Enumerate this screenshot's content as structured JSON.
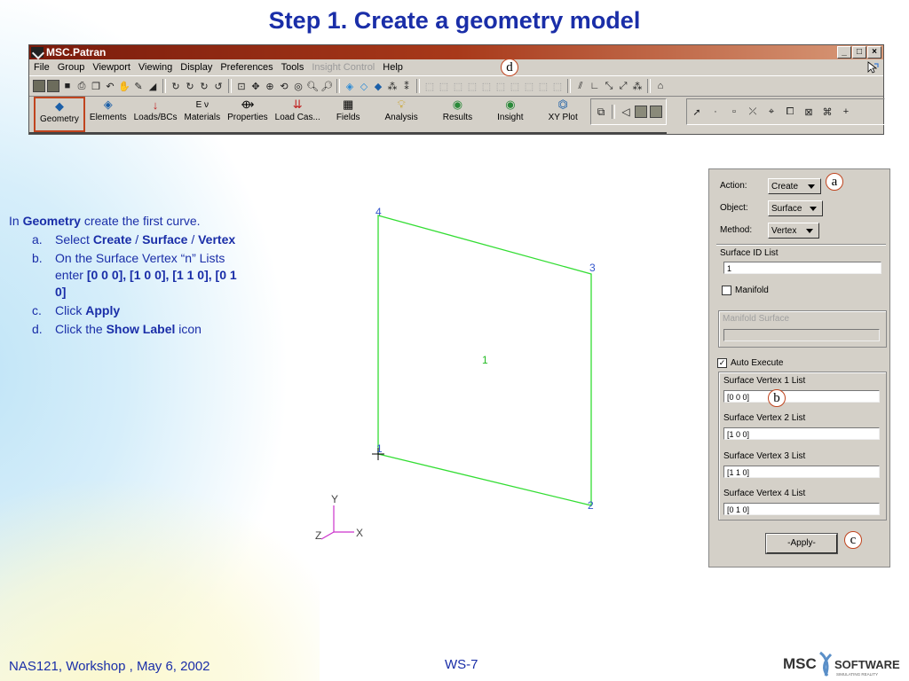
{
  "slide": {
    "title": "Step 1. Create a geometry model",
    "footer_left": "NAS121, Workshop , May 6, 2002",
    "footer_center": "WS-7",
    "logo_text_1": "MSC",
    "logo_text_2": "SOFTWARE",
    "logo_tagline": "SIMULATING REALITY"
  },
  "window": {
    "title": "MSC.Patran",
    "controls": [
      "_",
      "□",
      "×"
    ]
  },
  "menubar": {
    "items": [
      "File",
      "Group",
      "Viewport",
      "Viewing",
      "Display",
      "Preferences",
      "Tools",
      "Insight Control",
      "Help"
    ],
    "disabled": [
      "Insight Control"
    ]
  },
  "app_buttons": [
    {
      "label": "Geometry",
      "icon": "geometry-cube-icon",
      "active": true
    },
    {
      "label": "Elements",
      "icon": "elements-mesh-icon"
    },
    {
      "label": "Loads/BCs",
      "icon": "loads-arrow-icon"
    },
    {
      "label": "Materials",
      "icon": "materials-icon"
    },
    {
      "label": "Properties",
      "icon": "properties-icon"
    },
    {
      "label": "Load Cas...",
      "icon": "load-cases-icon"
    },
    {
      "label": "Fields",
      "icon": "fields-table-icon"
    },
    {
      "label": "Analysis",
      "icon": "analysis-bulb-icon"
    },
    {
      "label": "Results",
      "icon": "results-icon"
    },
    {
      "label": "Insight",
      "icon": "insight-icon"
    },
    {
      "label": "XY Plot",
      "icon": "xy-plot-icon"
    }
  ],
  "instructions": {
    "intro_pre": "In ",
    "intro_bold": "Geometry",
    "intro_post": " create the first curve.",
    "steps": [
      {
        "mark": "a.",
        "parts": [
          [
            "Select ",
            false
          ],
          [
            "Create",
            true
          ],
          [
            " / ",
            false
          ],
          [
            "Surface",
            true
          ],
          [
            " / ",
            false
          ],
          [
            "Vertex",
            true
          ]
        ]
      },
      {
        "mark": "b.",
        "parts": [
          [
            "On the Surface Vertex “n” Lists enter ",
            false
          ],
          [
            "[0 0 0], [1 0 0], [1 1 0], [0 1 0]",
            true
          ]
        ]
      },
      {
        "mark": "c.",
        "parts": [
          [
            "Click ",
            false
          ],
          [
            "Apply",
            true
          ]
        ]
      },
      {
        "mark": "d.",
        "parts": [
          [
            "Click the ",
            false
          ],
          [
            "Show Label",
            true
          ],
          [
            " icon",
            false
          ]
        ]
      }
    ]
  },
  "callouts": {
    "a": "a",
    "b": "b",
    "c": "c",
    "d": "d"
  },
  "form": {
    "action_label": "Action:",
    "action_value": "Create",
    "object_label": "Object:",
    "object_value": "Surface",
    "method_label": "Method:",
    "method_value": "Vertex",
    "surface_id_label": "Surface ID List",
    "surface_id_value": "1",
    "manifold_label": "Manifold",
    "manifold_checked": false,
    "manifold_surface_label": "Manifold Surface",
    "auto_execute_label": "Auto Execute",
    "auto_execute_checked": true,
    "vertex_lists": [
      {
        "label": "Surface Vertex 1 List",
        "value": "[0 0 0]"
      },
      {
        "label": "Surface Vertex 2 List",
        "value": "[1 0 0]"
      },
      {
        "label": "Surface Vertex 3 List",
        "value": "[1 1 0]"
      },
      {
        "label": "Surface Vertex 4 List",
        "value": "[0 1 0]"
      }
    ],
    "apply_label": "-Apply-"
  },
  "viewport": {
    "surface_label": "1",
    "vertex_labels": [
      "1",
      "2",
      "3",
      "4"
    ],
    "axis_labels": {
      "x": "X",
      "y": "Y",
      "z": "Z"
    },
    "edge_color": "#33dd33",
    "label_color_vertex": "#3355cc",
    "label_color_surface": "#22bb22",
    "axis_color": "#cc33cc"
  },
  "colors": {
    "title": "#1a2ea8",
    "accent_callout": "#c0441e",
    "panel_gray": "#d4d0c8"
  }
}
